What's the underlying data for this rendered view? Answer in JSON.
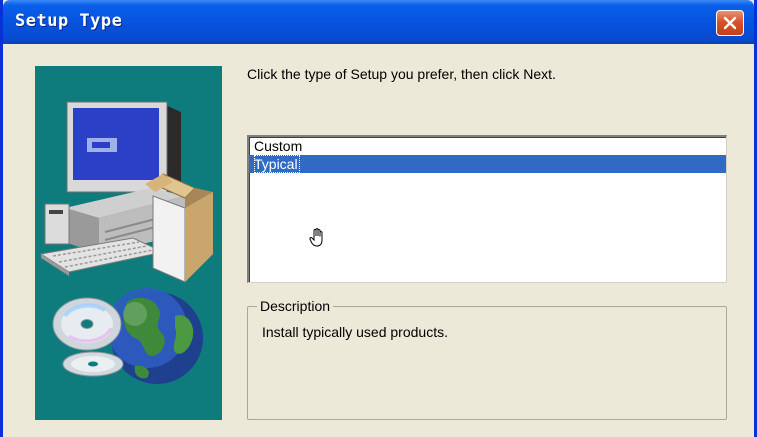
{
  "window": {
    "title": "Setup Type"
  },
  "main": {
    "prompt": "Click the type of Setup you prefer, then click Next.",
    "setup_types": [
      {
        "label": "Custom",
        "selected": false
      },
      {
        "label": "Typical",
        "selected": true
      }
    ],
    "description": {
      "legend": "Description",
      "text": "Install typically used products."
    }
  },
  "colors": {
    "title_bar": "#0553df",
    "dialog_background": "#ece9d8",
    "selection": "#316ac5",
    "illustration_background": "#0e7c7c",
    "close_button": "#d8532b"
  },
  "icons": [
    "close-icon",
    "computer-icon",
    "globe-icon",
    "cd-icon",
    "hand-pointer-icon"
  ]
}
